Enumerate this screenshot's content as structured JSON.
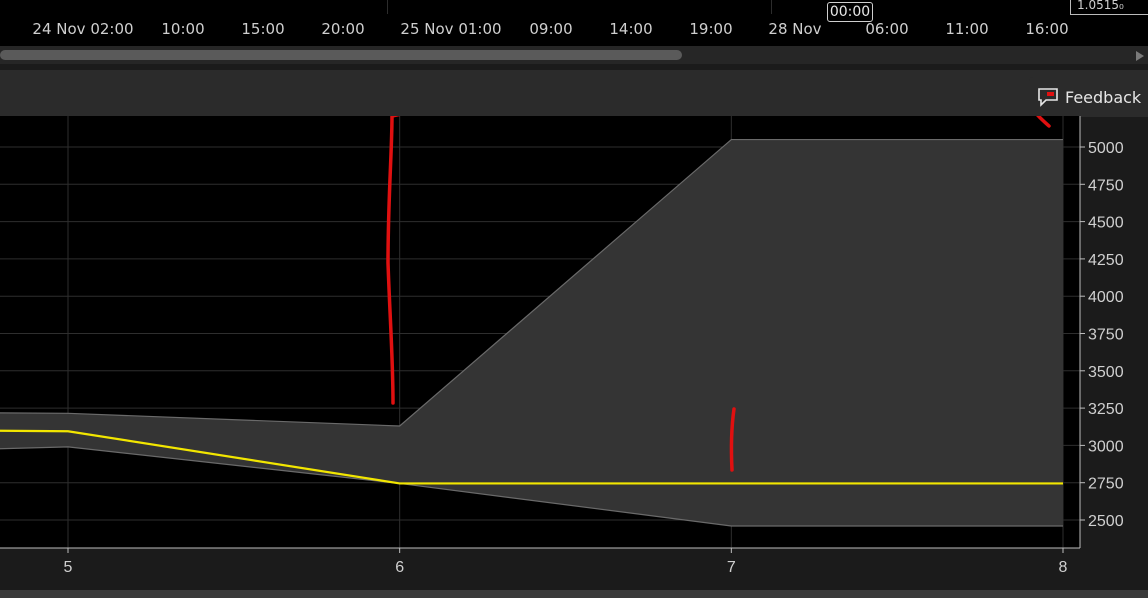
{
  "top_timeline": {
    "labels": [
      {
        "text": "24 Nov 02:00",
        "pos": 83
      },
      {
        "text": "10:00",
        "pos": 183
      },
      {
        "text": "15:00",
        "pos": 263
      },
      {
        "text": "20:00",
        "pos": 343
      },
      {
        "text": "25 Nov 01:00",
        "pos": 451
      },
      {
        "text": "09:00",
        "pos": 551
      },
      {
        "text": "14:00",
        "pos": 631
      },
      {
        "text": "19:00",
        "pos": 711
      },
      {
        "text": "28 Nov",
        "pos": 795
      },
      {
        "text": "06:00",
        "pos": 887
      },
      {
        "text": "11:00",
        "pos": 967
      },
      {
        "text": "16:00",
        "pos": 1047
      }
    ],
    "crosshair_time": "00:00",
    "corner_price": "1.0515₀"
  },
  "toolbar": {
    "feedback_label": "Feedback"
  },
  "colors": {
    "line": "#f2e600",
    "band_fill": "#343434",
    "band_edge": "#6a6a6a",
    "grid": "#2e2e2e",
    "annotation": "#e01010",
    "axis_text": "#d0d0d0"
  },
  "chart_data": {
    "type": "line",
    "xlim": [
      4,
      8
    ],
    "ylim": [
      2400,
      5200
    ],
    "x_ticks": [
      5,
      6,
      7,
      8
    ],
    "y_ticks": [
      2500,
      2750,
      3000,
      3250,
      3500,
      3750,
      4000,
      4250,
      4500,
      4750,
      5000
    ],
    "grid": true,
    "series": [
      {
        "role": "forecast",
        "x": [
          4,
          5,
          6,
          7,
          8
        ],
        "y": [
          3110,
          3095,
          2745,
          2745,
          2745
        ]
      }
    ],
    "band": {
      "x": [
        4,
        5,
        6,
        7,
        8
      ],
      "upper": [
        3230,
        3215,
        3130,
        5050,
        5050
      ],
      "lower": [
        2930,
        2990,
        2745,
        2460,
        2460
      ]
    }
  }
}
